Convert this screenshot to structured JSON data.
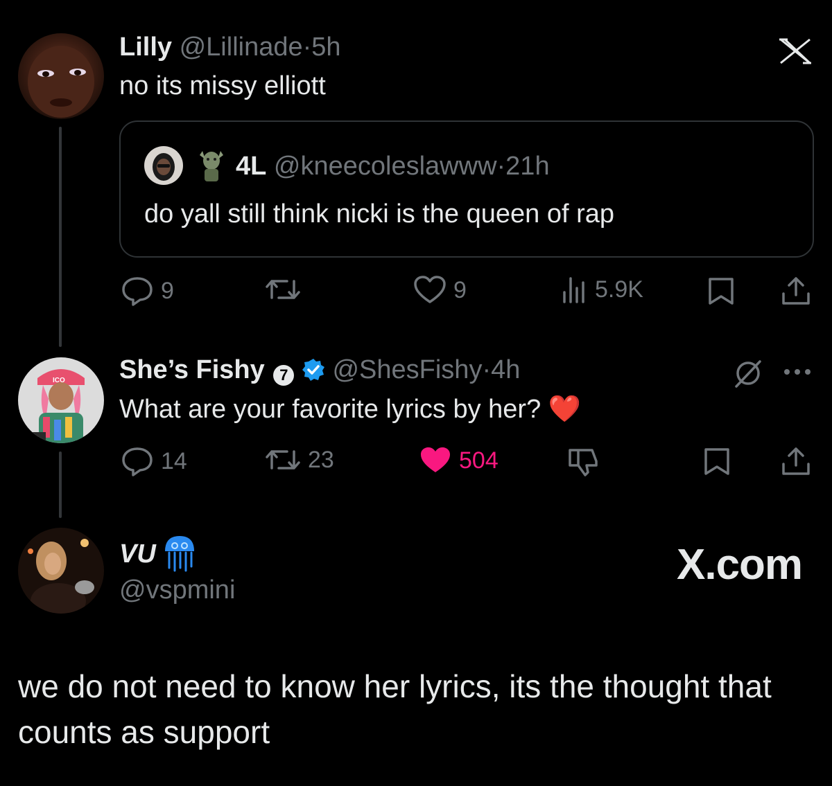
{
  "colors": {
    "background": "#000000",
    "text": "#e7e9ea",
    "muted": "#71767b",
    "like_pink": "#f91880",
    "verified_blue": "#1d9bf0",
    "border": "#2f3336"
  },
  "tweet1": {
    "name": "Lilly",
    "handle": "@Lillinade",
    "sep": "·",
    "time": "5h",
    "text": "no its missy elliott",
    "quote": {
      "name": "4L",
      "handle": "@kneecoleslawww",
      "sep": "·",
      "time": "21h",
      "text": "do yall still think nicki is the queen of rap"
    },
    "actions": {
      "replies": "9",
      "likes": "9",
      "views": "5.9K"
    }
  },
  "tweet2": {
    "name": "She’s Fishy",
    "badge_number": "7",
    "handle": "@ShesFishy",
    "sep": "·",
    "time": "4h",
    "text": "What are your favorite lyrics by her?",
    "emoji": "❤️",
    "actions": {
      "replies": "14",
      "reposts": "23",
      "likes": "504"
    }
  },
  "reply": {
    "name": "VU",
    "emoji_badge": "jellyfish",
    "handle": "@vspmini",
    "text": "we do not need to know her lyrics, its the thought that counts as support"
  },
  "brand": {
    "xcom": "X.com"
  },
  "icons": [
    "x-logo-icon",
    "reply-icon",
    "repost-icon",
    "like-icon",
    "views-icon",
    "bookmark-icon",
    "share-icon",
    "grok-icon",
    "more-icon",
    "verified-icon",
    "dislike-icon"
  ]
}
